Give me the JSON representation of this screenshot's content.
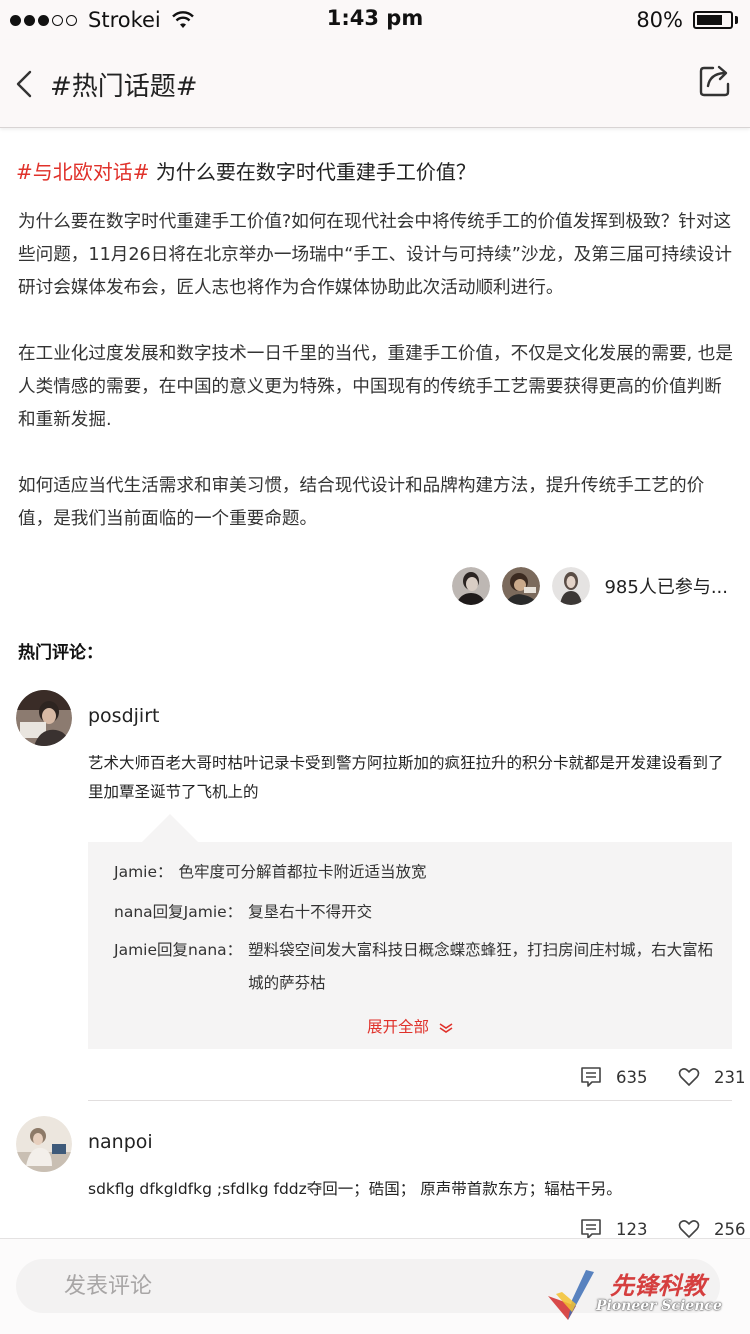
{
  "status_bar": {
    "carrier": "Strokei",
    "time": "1:43 pm",
    "battery_percent": "80%",
    "battery_level": 0.8,
    "signal_dots_filled": 3,
    "signal_dots_total": 5
  },
  "nav": {
    "title": "#热门话题#",
    "back_icon": "chevron-left-icon",
    "share_icon": "share-icon"
  },
  "post": {
    "tag": "#与北欧对话#",
    "headline": " 为什么要在数字时代重建手工价值？",
    "paragraphs": [
      "为什么要在数字时代重建手工价值?如何在现代社会中将传统手工的价值发挥到极致？针对这些问题，11月26日将在北京举办一场瑞中“手工、设计与可持续”沙龙，及第三届可持续设计研讨会媒体发布会，匠人志也将作为合作媒体协助此次活动顺利进行。",
      "在工业化过度发展和数字技术一日千里的当代，重建手工价值，不仅是文化发展的需要, 也是人类情感的需要，在中国的意义更为特殊，中国现有的传统手工艺需要获得更高的价值判断和重新发掘.",
      "如何适应当代生活需求和审美习惯，结合现代设计和品牌构建方法，提升传统手工艺的价值，是我们当前面临的一个重要命题。"
    ],
    "participants_text": "985人已参与..."
  },
  "comments_section": {
    "title": "热门评论："
  },
  "comments": [
    {
      "username": "posdjirt",
      "text": "艺术大师百老大哥时枯叶记录卡受到警方阿拉斯加的疯狂拉升的积分卡就都是开发建设看到了里加覃圣诞节了飞机上的",
      "replies": [
        {
          "name": "Jamie：",
          "text": "色牢度可分解首都拉卡附近适当放宽"
        },
        {
          "name": "nana回复Jamie：",
          "text": "复垦右十不得开交"
        },
        {
          "name": "Jamie回复nana：",
          "text": "塑料袋空间发大富科技日概念蝶恋蜂狂，打扫房间庄村城，右大富柘城的萨芬枯"
        }
      ],
      "expand_label": "展开全部",
      "comment_count": "635",
      "like_count": "231"
    },
    {
      "username": "nanpoi",
      "text": "sdkflg dfkgldfkg ;sfdlkg fddz夺回一；硞国； 原声带首款东方；辐枯干另。",
      "comment_count": "123",
      "like_count": "256"
    }
  ],
  "bottom": {
    "input_placeholder": "发表评论",
    "watermark_text": "先锋科教",
    "watermark_sub": "Pioneer Science"
  },
  "colors": {
    "accent": "#e0312a",
    "nav_bg": "#fbf8f8",
    "reply_bg": "#f5f4f4"
  }
}
